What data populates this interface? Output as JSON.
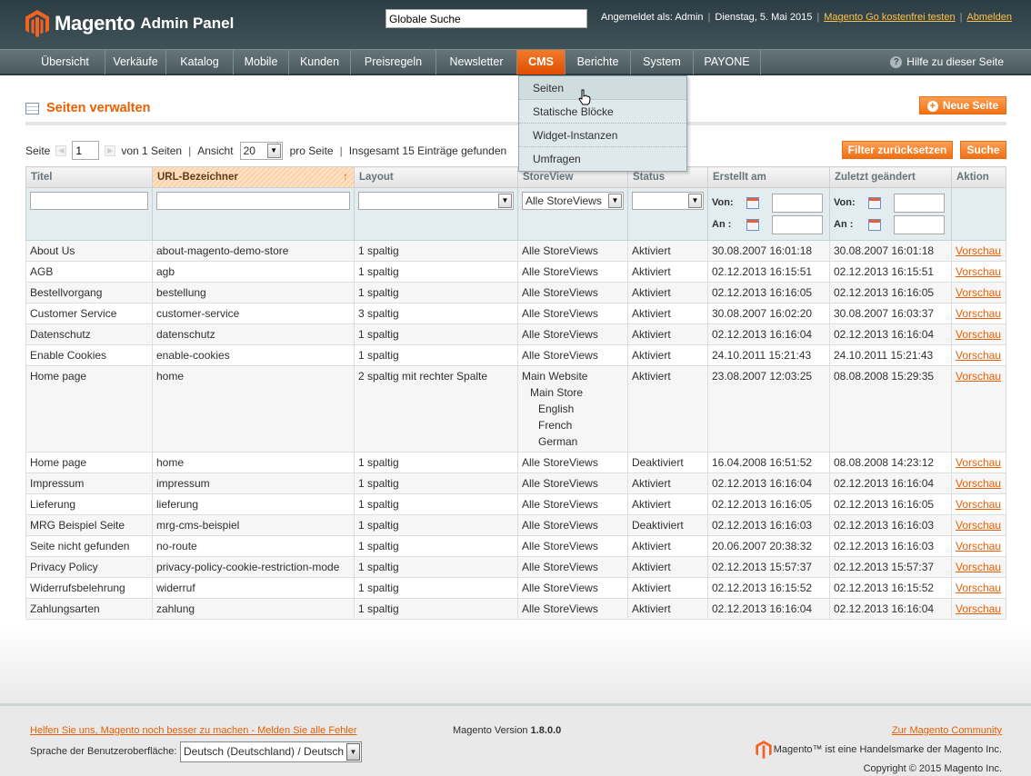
{
  "header": {
    "logo_brand": "Magento",
    "logo_sub": "Admin Panel",
    "search_value": "Globale Suche",
    "logged_in": "Angemeldet als: Admin",
    "date": "Dienstag, 5. Mai 2015",
    "trial_link": "Magento Go kostenfrei testen",
    "logout_link": "Abmelden"
  },
  "nav": {
    "items": [
      "Übersicht",
      "Verkäufe",
      "Katalog",
      "Mobile",
      "Kunden",
      "Preisregeln",
      "Newsletter",
      "CMS",
      "Berichte",
      "System",
      "PAYONE"
    ],
    "active": "CMS",
    "help": "Hilfe zu dieser Seite"
  },
  "cms_menu": [
    "Seiten",
    "Statische Blöcke",
    "Widget-Instanzen",
    "Umfragen"
  ],
  "page": {
    "title": "Seiten verwalten",
    "new_button": "Neue Seite",
    "reset_button": "Filter zurücksetzen",
    "search_button": "Suche"
  },
  "pager": {
    "page_label": "Seite",
    "page_value": "1",
    "of_pages": "von 1 Seiten",
    "view_label": "Ansicht",
    "per_page": "20",
    "per_page_label": "pro Seite",
    "total": "Insgesamt 15 Einträge gefunden"
  },
  "grid": {
    "columns": [
      "Titel",
      "URL-Bezeichner",
      "Layout",
      "StoreView",
      "Status",
      "Erstellt am",
      "Zuletzt geändert",
      "Aktion"
    ],
    "filter": {
      "storeview": "Alle StoreViews",
      "from": "Von:",
      "to": "An :"
    },
    "action_label": "Vorschau",
    "rows": [
      {
        "title": "About Us",
        "url": "about-magento-demo-store",
        "layout": "1 spaltig",
        "storeview": [
          "Alle StoreViews"
        ],
        "status": "Aktiviert",
        "created": "30.08.2007 16:01:18",
        "modified": "30.08.2007 16:01:18"
      },
      {
        "title": "AGB",
        "url": "agb",
        "layout": "1 spaltig",
        "storeview": [
          "Alle StoreViews"
        ],
        "status": "Aktiviert",
        "created": "02.12.2013 16:15:51",
        "modified": "02.12.2013 16:15:51"
      },
      {
        "title": "Bestellvorgang",
        "url": "bestellung",
        "layout": "1 spaltig",
        "storeview": [
          "Alle StoreViews"
        ],
        "status": "Aktiviert",
        "created": "02.12.2013 16:16:05",
        "modified": "02.12.2013 16:16:05"
      },
      {
        "title": "Customer Service",
        "url": "customer-service",
        "layout": "3 spaltig",
        "storeview": [
          "Alle StoreViews"
        ],
        "status": "Aktiviert",
        "created": "30.08.2007 16:02:20",
        "modified": "30.08.2007 16:03:37"
      },
      {
        "title": "Datenschutz",
        "url": "datenschutz",
        "layout": "1 spaltig",
        "storeview": [
          "Alle StoreViews"
        ],
        "status": "Aktiviert",
        "created": "02.12.2013 16:16:04",
        "modified": "02.12.2013 16:16:04"
      },
      {
        "title": "Enable Cookies",
        "url": "enable-cookies",
        "layout": "1 spaltig",
        "storeview": [
          "Alle StoreViews"
        ],
        "status": "Aktiviert",
        "created": "24.10.2011 15:21:43",
        "modified": "24.10.2011 15:21:43"
      },
      {
        "title": "Home page",
        "url": "home",
        "layout": "2 spaltig mit rechter Spalte",
        "storeview": [
          "Main Website",
          "Main Store",
          "English",
          "French",
          "German"
        ],
        "status": "Aktiviert",
        "created": "23.08.2007 12:03:25",
        "modified": "08.08.2008 15:29:35"
      },
      {
        "title": "Home page",
        "url": "home",
        "layout": "1 spaltig",
        "storeview": [
          "Alle StoreViews"
        ],
        "status": "Deaktiviert",
        "created": "16.04.2008 16:51:52",
        "modified": "08.08.2008 14:23:12"
      },
      {
        "title": "Impressum",
        "url": "impressum",
        "layout": "1 spaltig",
        "storeview": [
          "Alle StoreViews"
        ],
        "status": "Aktiviert",
        "created": "02.12.2013 16:16:04",
        "modified": "02.12.2013 16:16:04"
      },
      {
        "title": "Lieferung",
        "url": "lieferung",
        "layout": "1 spaltig",
        "storeview": [
          "Alle StoreViews"
        ],
        "status": "Aktiviert",
        "created": "02.12.2013 16:16:05",
        "modified": "02.12.2013 16:16:05"
      },
      {
        "title": "MRG Beispiel Seite",
        "url": "mrg-cms-beispiel",
        "layout": "1 spaltig",
        "storeview": [
          "Alle StoreViews"
        ],
        "status": "Deaktiviert",
        "created": "02.12.2013 16:16:03",
        "modified": "02.12.2013 16:16:03"
      },
      {
        "title": "Seite nicht gefunden",
        "url": "no-route",
        "layout": "1 spaltig",
        "storeview": [
          "Alle StoreViews"
        ],
        "status": "Aktiviert",
        "created": "20.06.2007 20:38:32",
        "modified": "02.12.2013 16:16:03"
      },
      {
        "title": "Privacy Policy",
        "url": "privacy-policy-cookie-restriction-mode",
        "layout": "1 spaltig",
        "storeview": [
          "Alle StoreViews"
        ],
        "status": "Aktiviert",
        "created": "02.12.2013 15:57:37",
        "modified": "02.12.2013 15:57:37"
      },
      {
        "title": "Widerrufsbelehrung",
        "url": "widerruf",
        "layout": "1 spaltig",
        "storeview": [
          "Alle StoreViews"
        ],
        "status": "Aktiviert",
        "created": "02.12.2013 16:15:52",
        "modified": "02.12.2013 16:15:52"
      },
      {
        "title": "Zahlungsarten",
        "url": "zahlung",
        "layout": "1 spaltig",
        "storeview": [
          "Alle StoreViews"
        ],
        "status": "Aktiviert",
        "created": "02.12.2013 16:16:04",
        "modified": "02.12.2013 16:16:04"
      }
    ]
  },
  "footer": {
    "bug_link": "Helfen Sie uns, Magento noch besser zu machen - Melden Sie alle Fehler",
    "version_label": "Magento Version",
    "version": "1.8.0.0",
    "community_link": "Zur Magento Community",
    "language_label": "Sprache der Benutzeroberfläche:",
    "language": "Deutsch (Deutschland) / Deutsch",
    "trademark": "Magento™ ist eine Handelsmarke der Magento Inc.",
    "copyright": "Copyright © 2015 Magento Inc."
  },
  "colors": {
    "accent": "#eb5e00",
    "header_bg": "#2c3e44",
    "nav_bg": "#55666b"
  }
}
